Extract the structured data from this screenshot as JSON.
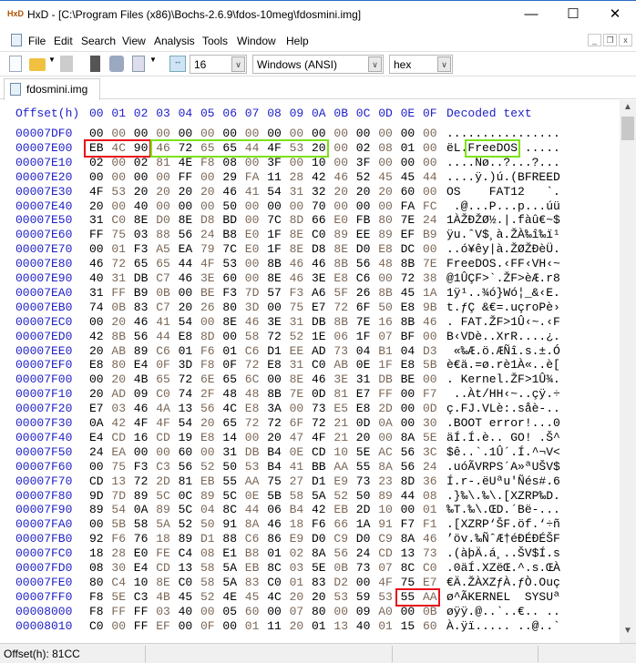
{
  "window": {
    "title": "HxD - [C:\\Program Files (x86)\\Bochs-2.6.9\\fdos-10meg\\fdosmini.img]",
    "minimize": "—",
    "maximize": "☐",
    "close": "✕"
  },
  "menu": [
    "File",
    "Edit",
    "Search",
    "View",
    "Analysis",
    "Tools",
    "Window",
    "Help"
  ],
  "mdi": {
    "minimize": "_",
    "restore": "❐",
    "close": "x"
  },
  "toolbar": {
    "bytes_per_row": "16",
    "charset": "Windows (ANSI)",
    "offset_base": "hex"
  },
  "tab": {
    "label": "fdosmini.img"
  },
  "header": {
    "offset": "Offset(h)",
    "columns": [
      "00",
      "01",
      "02",
      "03",
      "04",
      "05",
      "06",
      "07",
      "08",
      "09",
      "0A",
      "0B",
      "0C",
      "0D",
      "0E",
      "0F"
    ],
    "decoded": "Decoded text"
  },
  "rows": [
    {
      "offset": "00007DF0",
      "hex": "00 00 00 00 00 00 00 00 00 00 00 00 00 00 00 00",
      "text": "................"
    },
    {
      "offset": "00007E00",
      "hex": "EB 4C 90 46 72 65 65 44 4F 53 20 00 02 08 01 00",
      "text": "ëL.FreeDOS ....."
    },
    {
      "offset": "00007E10",
      "hex": "02 00 02 81 4E F8 08 00 3F 00 10 00 3F 00 00 00",
      "text": "....Nø..?...?..."
    },
    {
      "offset": "00007E20",
      "hex": "00 00 00 00 FF 00 29 FA 11 28 42 46 52 45 45 44",
      "text": "....ÿ.)ú.(BFREED"
    },
    {
      "offset": "00007E30",
      "hex": "4F 53 20 20 20 20 46 41 54 31 32 20 20 20 60 00",
      "text": "OS    FAT12   `."
    },
    {
      "offset": "00007E40",
      "hex": "20 00 40 00 00 00 50 00 00 00 70 00 00 00 FA FC",
      "text": " .@...P...p...úü"
    },
    {
      "offset": "00007E50",
      "hex": "31 C0 8E D0 8E D8 BD 00 7C 8D 66 E0 FB 80 7E 24",
      "text": "1ÀŽÐŽØ½.|.fàû€~$"
    },
    {
      "offset": "00007E60",
      "hex": "FF 75 03 88 56 24 B8 E0 1F 8E C0 89 EE 89 EF B9",
      "text": "ÿu.ˆV$¸à.ŽÀ‰î‰ï¹"
    },
    {
      "offset": "00007E70",
      "hex": "00 01 F3 A5 EA 79 7C E0 1F 8E D8 8E D0 E8 DC 00",
      "text": "..ó¥êy|à.ŽØŽÐèÜ."
    },
    {
      "offset": "00007E80",
      "hex": "46 72 65 65 44 4F 53 00 8B 46 46 8B 56 48 8B 7E",
      "text": "FreeDOS.‹FF‹VH‹~"
    },
    {
      "offset": "00007E90",
      "hex": "40 31 DB C7 46 3E 60 00 8E 46 3E E8 C6 00 72 38",
      "text": "@1ÛÇF>`.ŽF>èÆ.r8"
    },
    {
      "offset": "00007EA0",
      "hex": "31 FF B9 0B 00 BE F3 7D 57 F3 A6 5F 26 8B 45 1A",
      "text": "1ÿ¹..¾ó}Wó¦_&‹E."
    },
    {
      "offset": "00007EB0",
      "hex": "74 0B 83 C7 20 26 80 3D 00 75 E7 72 6F 50 E8 9B",
      "text": "t.ƒÇ &€=.uçroPè›"
    },
    {
      "offset": "00007EC0",
      "hex": "00 20 46 41 54 00 8E 46 3E 31 DB 8B 7E 16 8B 46",
      "text": ". FAT.ŽF>1Û‹~.‹F"
    },
    {
      "offset": "00007ED0",
      "hex": "42 8B 56 44 E8 8D 00 58 72 52 1E 06 1F 07 BF 00",
      "text": "B‹VDè..XrR....¿."
    },
    {
      "offset": "00007EE0",
      "hex": "20 AB 89 C6 01 F6 01 C6 D1 EE AD 73 04 B1 04 D3",
      "text": " «‰Æ.ö.ÆÑî.s.±.Ó"
    },
    {
      "offset": "00007EF0",
      "hex": "E8 80 E4 0F 3D F8 0F 72 E8 31 C0 AB 0E 1F E8 5B",
      "text": "è€ä.=ø.rè1À«..è["
    },
    {
      "offset": "00007F00",
      "hex": "00 20 4B 65 72 6E 65 6C 00 8E 46 3E 31 DB BE 00",
      "text": ". Kernel.ŽF>1Û¾."
    },
    {
      "offset": "00007F10",
      "hex": "20 AD 09 C0 74 2F 48 48 8B 7E 0D 81 E7 FF 00 F7",
      "text": " ..Àt/HH‹~..çÿ.÷"
    },
    {
      "offset": "00007F20",
      "hex": "E7 03 46 4A 13 56 4C E8 3A 00 73 E5 E8 2D 00 0D",
      "text": "ç.FJ.VLè:.såè-.."
    },
    {
      "offset": "00007F30",
      "hex": "0A 42 4F 4F 54 20 65 72 72 6F 72 21 0D 0A 00 30",
      "text": ".BOOT error!...0"
    },
    {
      "offset": "00007F40",
      "hex": "E4 CD 16 CD 19 E8 14 00 20 47 4F 21 20 00 8A 5E",
      "text": "äÍ.Í.è.. GO! .Š^"
    },
    {
      "offset": "00007F50",
      "hex": "24 EA 00 00 60 00 31 DB B4 0E CD 10 5E AC 56 3C",
      "text": "$ê..`.1Û´.Í.^¬V<"
    },
    {
      "offset": "00007F60",
      "hex": "00 75 F3 C3 56 52 50 53 B4 41 BB AA 55 8A 56 24",
      "text": ".uóÃVRPS´A»ªUŠV$"
    },
    {
      "offset": "00007F70",
      "hex": "CD 13 72 2D 81 EB 55 AA 75 27 D1 E9 73 23 8D 36",
      "text": "Í.r-.ëUªu'Ñés#.6"
    },
    {
      "offset": "00007F80",
      "hex": "9D 7D 89 5C 0C 89 5C 0E 5B 58 5A 52 50 89 44 08",
      "text": ".}‰\\.‰\\.[XZRP‰D."
    },
    {
      "offset": "00007F90",
      "hex": "89 54 0A 89 5C 04 8C 44 06 B4 42 EB 2D 10 00 01",
      "text": "‰T.‰\\.ŒD.´Bë-..."
    },
    {
      "offset": "00007FA0",
      "hex": "00 5B 58 5A 52 50 91 8A 46 18 F6 66 1A 91 F7 F1",
      "text": ".[XZRP‘ŠF.öf.‘÷ñ"
    },
    {
      "offset": "00007FB0",
      "hex": "92 F6 76 18 89 D1 88 C6 86 E9 D0 C9 D0 C9 8A 46",
      "text": "’öv.‰ÑˆÆ†éÐÉÐÉŠF"
    },
    {
      "offset": "00007FC0",
      "hex": "18 28 E0 FE C4 08 E1 B8 01 02 8A 56 24 CD 13 73",
      "text": ".(àþÄ.á¸..ŠV$Í.s"
    },
    {
      "offset": "00007FD0",
      "hex": "08 30 E4 CD 13 58 5A EB 8C 03 5E 0B 73 07 8C C0",
      "text": ".0äÍ.XZëŒ.^.s.ŒÀ"
    },
    {
      "offset": "00007FE0",
      "hex": "80 C4 10 8E C0 58 5A 83 C0 01 83 D2 00 4F 75 E7",
      "text": "€Ä.ŽÀXZƒÀ.ƒÒ.Ouç"
    },
    {
      "offset": "00007FF0",
      "hex": "F8 5E C3 4B 45 52 4E 45 4C 20 20 53 59 53 55 AA",
      "text": "ø^ÃKERNEL  SYSUª"
    },
    {
      "offset": "00008000",
      "hex": "F8 FF FF 03 40 00 05 60 00 07 80 00 09 A0 00 0B",
      "text": "øÿÿ.@..`..€.. .."
    },
    {
      "offset": "00008010",
      "hex": "C0 00 FF EF 00 0F 00 01 11 20 01 13 40 01 15 60",
      "text": "À.ÿï..... ..@..`"
    }
  ],
  "highlights": [
    {
      "row": 1,
      "from": 0,
      "to": 2,
      "area": "hex",
      "color": "#e8101a"
    },
    {
      "row": 1,
      "from": 3,
      "to": 10,
      "area": "hex",
      "color": "#7ee21a"
    },
    {
      "row": 1,
      "from": 3,
      "to": 9,
      "area": "text",
      "color": "#7ee21a"
    },
    {
      "row": 32,
      "from": 14,
      "to": 15,
      "area": "hex",
      "color": "#e8101a"
    }
  ],
  "status": {
    "offset": "Offset(h): 81CC"
  },
  "scrollbar": {
    "up": "▲",
    "down": "▼"
  }
}
